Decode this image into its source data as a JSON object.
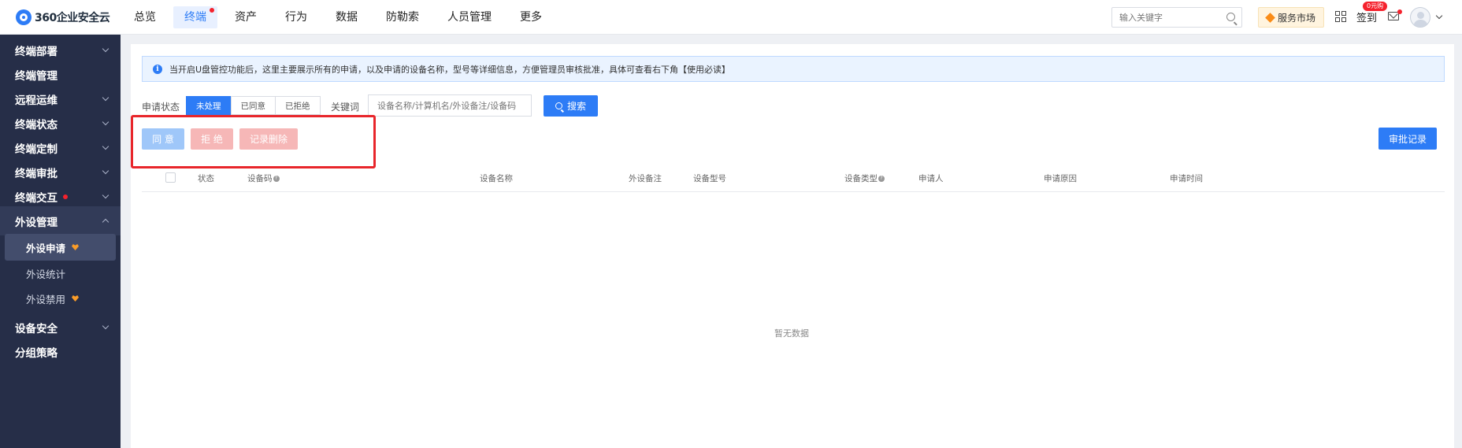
{
  "brand": {
    "name": "360企业安全云"
  },
  "nav": [
    {
      "label": "总览",
      "active": false,
      "dot": false
    },
    {
      "label": "终端",
      "active": true,
      "dot": true
    },
    {
      "label": "资产",
      "active": false,
      "dot": false
    },
    {
      "label": "行为",
      "active": false,
      "dot": false
    },
    {
      "label": "数据",
      "active": false,
      "dot": false
    },
    {
      "label": "防勒索",
      "active": false,
      "dot": false
    },
    {
      "label": "人员管理",
      "active": false,
      "dot": false
    },
    {
      "label": "更多",
      "active": false,
      "dot": false
    }
  ],
  "header": {
    "search_placeholder": "输入关键字",
    "market_label": "服务市场",
    "signin_label": "签到",
    "coupon_badge": "0元购"
  },
  "sidebar": {
    "items": [
      {
        "label": "终端部署"
      },
      {
        "label": "终端管理"
      },
      {
        "label": "远程运维"
      },
      {
        "label": "终端状态"
      },
      {
        "label": "终端定制"
      },
      {
        "label": "终端审批"
      },
      {
        "label": "终端交互"
      },
      {
        "label": "外设管理"
      },
      {
        "label": "设备安全"
      },
      {
        "label": "分组策略"
      }
    ],
    "subitems": [
      {
        "label": "外设申请"
      },
      {
        "label": "外设统计"
      },
      {
        "label": "外设禁用"
      }
    ]
  },
  "notice": {
    "text": "当开启U盘管控功能后，这里主要展示所有的申请，以及申请的设备名称，型号等详细信息，方便管理员审核批准，具体可查看右下角【使用必读】"
  },
  "filters": {
    "status_label": "申请状态",
    "status_options": [
      "未处理",
      "已同意",
      "已拒绝"
    ],
    "selected_status": "未处理",
    "keyword_label": "关键词",
    "keyword_placeholder": "设备名称/计算机名/外设备注/设备码",
    "search_button": "搜索"
  },
  "actions": {
    "agree": "同 意",
    "reject": "拒 绝",
    "delete_record": "记录删除",
    "approval_record": "审批记录"
  },
  "table": {
    "columns": [
      "状态",
      "设备码",
      "设备名称",
      "外设备注",
      "设备型号",
      "设备类型",
      "申请人",
      "申请原因",
      "申请时间"
    ],
    "empty_text": "暂无数据"
  },
  "colors": {
    "primary": "#2d7cf6",
    "danger": "#e8262b",
    "sidebar_bg": "#262e48"
  }
}
